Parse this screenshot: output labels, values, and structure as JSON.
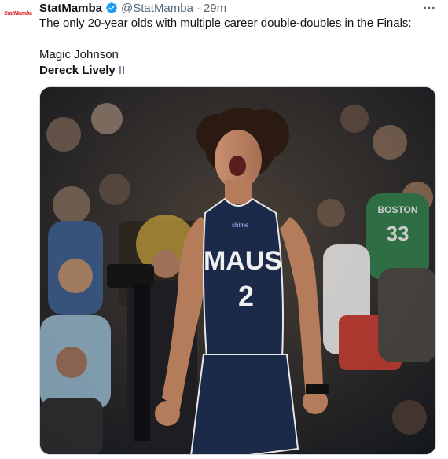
{
  "author": {
    "avatar_text": "StatMamba",
    "display_name": "StatMamba",
    "handle": "@StatMamba",
    "separator": "·",
    "time": "29m",
    "verified": true
  },
  "tweet": {
    "text": "The only 20-year olds with multiple career double-doubles in the Finals:",
    "players": [
      {
        "name": "Magic Johnson",
        "bold": false,
        "suffix": ""
      },
      {
        "name": "Dereck Lively",
        "bold": true,
        "suffix": " II"
      }
    ]
  },
  "media": {
    "jersey_text": "MAUS",
    "jersey_number": "2",
    "sponsor": "chime",
    "background_jersey_text": "BOSTON",
    "background_jersey_number": "33"
  },
  "colors": {
    "text_primary": "#0f1419",
    "text_secondary": "#536471",
    "verified_blue": "#1d9bf0",
    "jersey_navy": "#1c2a4a",
    "celtics_green": "#2f7a4a"
  },
  "icons": {
    "verified": "verified-badge-icon",
    "more": "more-options-icon"
  }
}
